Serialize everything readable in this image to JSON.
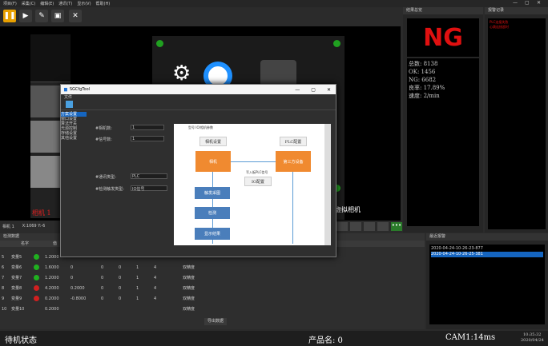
{
  "menu": [
    "项目(F)",
    "采集(C)",
    "编辑(E)",
    "通讯(T)",
    "显示(V)",
    "帮助(H)"
  ],
  "window_controls": [
    "—",
    "▢",
    "✕"
  ],
  "toolbar_icons": [
    "pause-icon",
    "play-icon",
    "edit-icon",
    "image-icon",
    "tools-icon"
  ],
  "result_panel": {
    "title": "结果总览",
    "verdict": "NG",
    "total": "总数: 8138",
    "ok": "OK: 1456",
    "ng": "NG: 6682",
    "rate": "良率: 17.89%",
    "speed": "速度:  2/min"
  },
  "alarm_panel": {
    "title": "报警记录",
    "items": [
      "PLC连接失败",
      "心跳连接超时"
    ]
  },
  "camera_view": {
    "label_left": "相机 1",
    "label_right": "虚拟相机"
  },
  "cam_status": {
    "name": "相机 1",
    "coords": "X:1069 Y:-6"
  },
  "detect_panel": {
    "title": "检测数据",
    "col_name": "名字",
    "col_val": "值",
    "rows": [
      {
        "no": "5",
        "name": "变量5",
        "state": "ok",
        "val": "1.2000",
        "a": "",
        "b": "",
        "c": "",
        "d": "",
        "e": "",
        "f": "",
        "type": ""
      },
      {
        "no": "6",
        "name": "变量6",
        "state": "ok",
        "val": "1.6000",
        "a": "0",
        "b": "0",
        "c": "0",
        "d": "1",
        "e": "4",
        "f": "",
        "type": "双精度"
      },
      {
        "no": "7",
        "name": "变量7",
        "state": "ok",
        "val": "1.2000",
        "a": "0",
        "b": "0",
        "c": "0",
        "d": "1",
        "e": "4",
        "f": "",
        "type": "双精度"
      },
      {
        "no": "8",
        "name": "变量8",
        "state": "ng",
        "val": "4.2000",
        "a": "0.2000",
        "b": "0",
        "c": "0",
        "d": "1",
        "e": "4",
        "f": "",
        "type": "双精度"
      },
      {
        "no": "9",
        "name": "变量9",
        "state": "ng",
        "val": "0.2000",
        "a": "-0.8000",
        "b": "0",
        "c": "0",
        "d": "1",
        "e": "4",
        "f": "",
        "type": "双精度"
      },
      {
        "no": "10",
        "name": "变量10",
        "state": "",
        "val": "0.2000",
        "a": "",
        "b": "",
        "c": "",
        "d": "",
        "e": "",
        "f": "",
        "type": "双精度"
      }
    ],
    "export": "导出数据"
  },
  "recent_alarm": {
    "title": "最近报警",
    "items": [
      "2020-04-24-10-26-23-877",
      "2020-04-24-10-26-25-381"
    ]
  },
  "statusbar": {
    "state": "待机状态",
    "product": "产品名: 0",
    "cam": "CAM1:14ms",
    "time": "10:35:32",
    "date": "2020/04/24"
  },
  "dialog": {
    "title": "SGCfgTool",
    "menu": "文件",
    "nav": [
      "方案设置",
      "窗口设置",
      "算法开关",
      "光源控制",
      "存储设置",
      "其他设置"
    ],
    "fields": [
      {
        "label": "#相机数:",
        "value": "1"
      },
      {
        "label": "#信号数:",
        "value": "1"
      },
      {
        "label": "#通讯类型:",
        "value": "PLC"
      },
      {
        "label": "#检测触发类型:",
        "value": "IO信号"
      }
    ],
    "diagram": {
      "top": "型号 IO/相机参数",
      "camera_param": "相机设置",
      "plc_param": "PLC配置",
      "camera": "相机",
      "third": "第三方设备",
      "comm": "写入板PLC信号",
      "io": "IO配置",
      "trigger": "触发采图",
      "detect": "检测",
      "show": "显示结果"
    }
  }
}
